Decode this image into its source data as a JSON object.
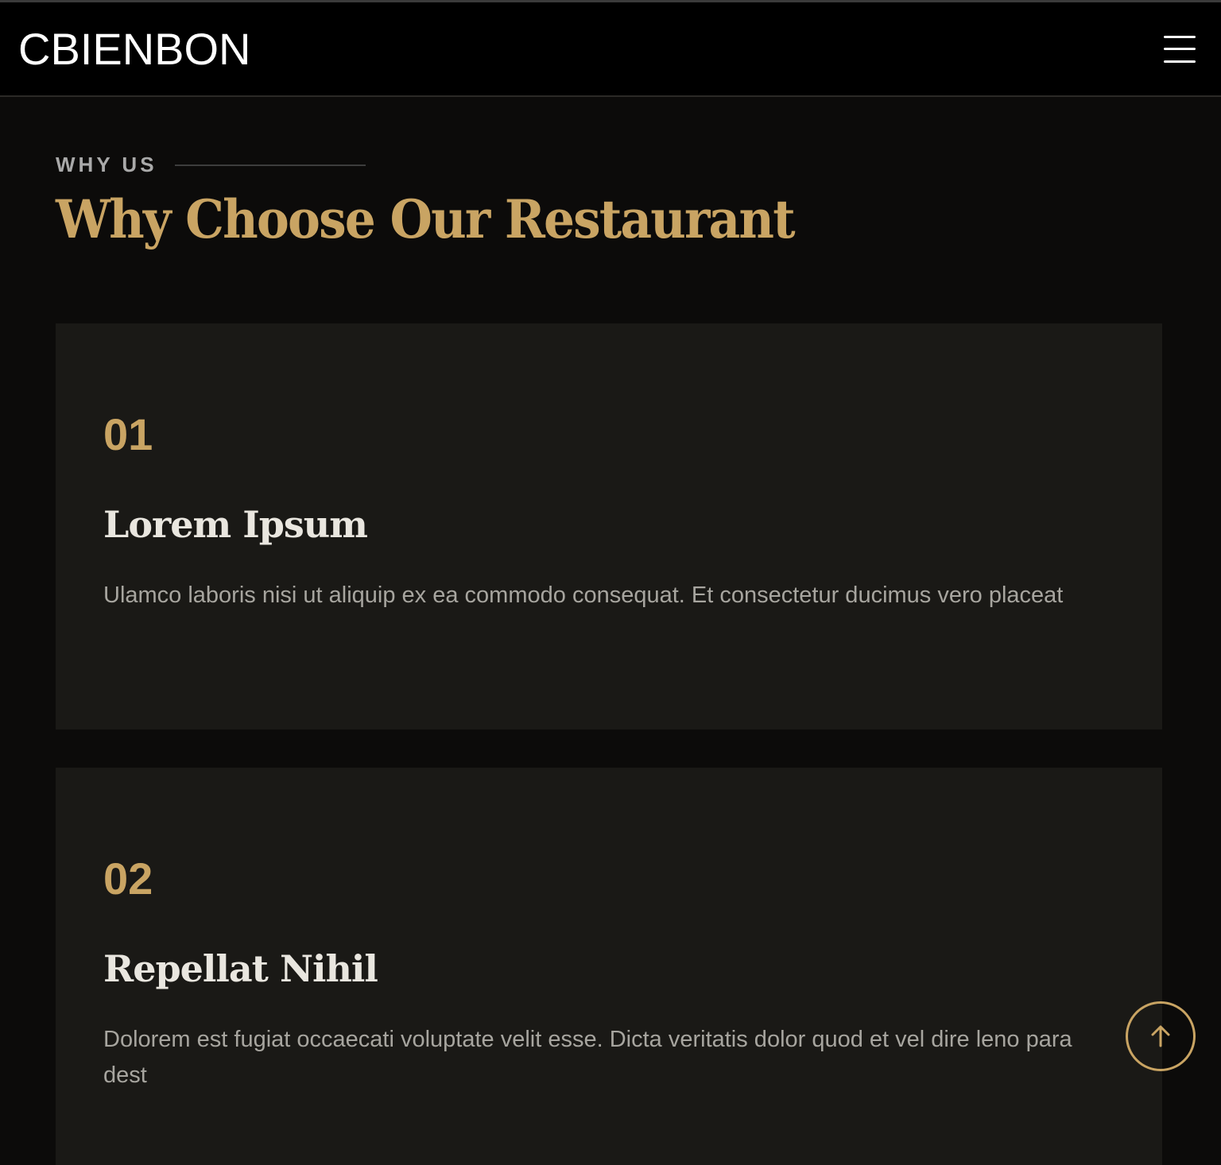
{
  "header": {
    "logo": "CBIENBON",
    "menu_icon": "hamburger-icon"
  },
  "section": {
    "eyebrow": "WHY US",
    "title": "Why Choose Our Restaurant",
    "cards": [
      {
        "number": "01",
        "title": "Lorem Ipsum",
        "description": "Ulamco laboris nisi ut aliquip ex ea commodo consequat. Et consectetur ducimus vero placeat"
      },
      {
        "number": "02",
        "title": "Repellat Nihil",
        "description": "Dolorem est fugiat occaecati voluptate velit esse. Dicta veritatis dolor quod et vel dire leno para dest"
      }
    ]
  },
  "scroll_top_icon": "arrow-up-icon",
  "colors": {
    "accent": "#c9a463",
    "background": "#0c0b0a",
    "card": "#1a1916",
    "header": "#000000"
  }
}
